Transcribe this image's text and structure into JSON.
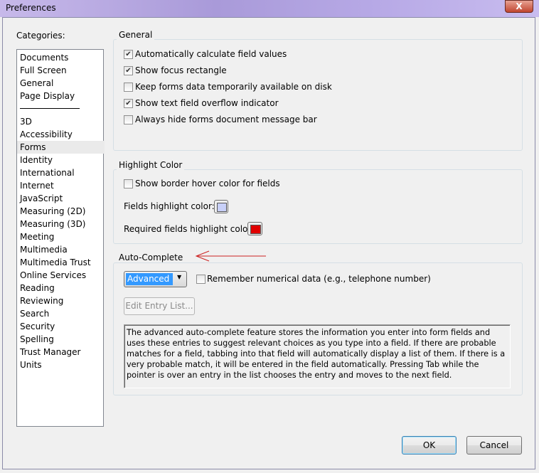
{
  "window": {
    "title": "Preferences",
    "close_label": "X"
  },
  "categories": {
    "label": "Categories:",
    "items": [
      "Documents",
      "Full Screen",
      "General",
      "Page Display",
      "3D",
      "Accessibility",
      "Forms",
      "Identity",
      "International",
      "Internet",
      "JavaScript",
      "Measuring (2D)",
      "Measuring (3D)",
      "Meeting",
      "Multimedia",
      "Multimedia Trust",
      "Online Services",
      "Reading",
      "Reviewing",
      "Search",
      "Security",
      "Spelling",
      "Trust Manager",
      "Units"
    ],
    "selected": "Forms"
  },
  "general": {
    "title": "General",
    "options": [
      {
        "label": "Automatically calculate field values",
        "checked": true
      },
      {
        "label": "Show focus rectangle",
        "checked": true
      },
      {
        "label": "Keep forms data temporarily available on disk",
        "checked": false
      },
      {
        "label": "Show text field overflow indicator",
        "checked": true
      },
      {
        "label": "Always hide forms document message bar",
        "checked": false
      }
    ]
  },
  "highlight": {
    "title": "Highlight Color",
    "hover_label": "Show border hover color for fields",
    "hover_checked": false,
    "fields_label": "Fields highlight color:",
    "fields_color": "#c8d0f8",
    "required_label": "Required fields highlight color:",
    "required_color": "#e00000"
  },
  "autocomplete": {
    "title": "Auto-Complete",
    "mode": "Advanced",
    "remember_label": "Remember numerical data (e.g., telephone number)",
    "remember_checked": false,
    "edit_button": "Edit Entry List...",
    "description": "The advanced auto-complete feature stores the information you enter into form fields and uses these entries to suggest relevant choices as you type into a field. If there are probable matches for a field, tabbing into that field will automatically display a list of them. If there is a very probable match, it will be entered in the field automatically. Pressing Tab while the pointer is over an entry in the list chooses the entry and moves to the next field."
  },
  "buttons": {
    "ok": "OK",
    "cancel": "Cancel"
  },
  "annotation": {
    "arrow_color": "#cc2222"
  }
}
